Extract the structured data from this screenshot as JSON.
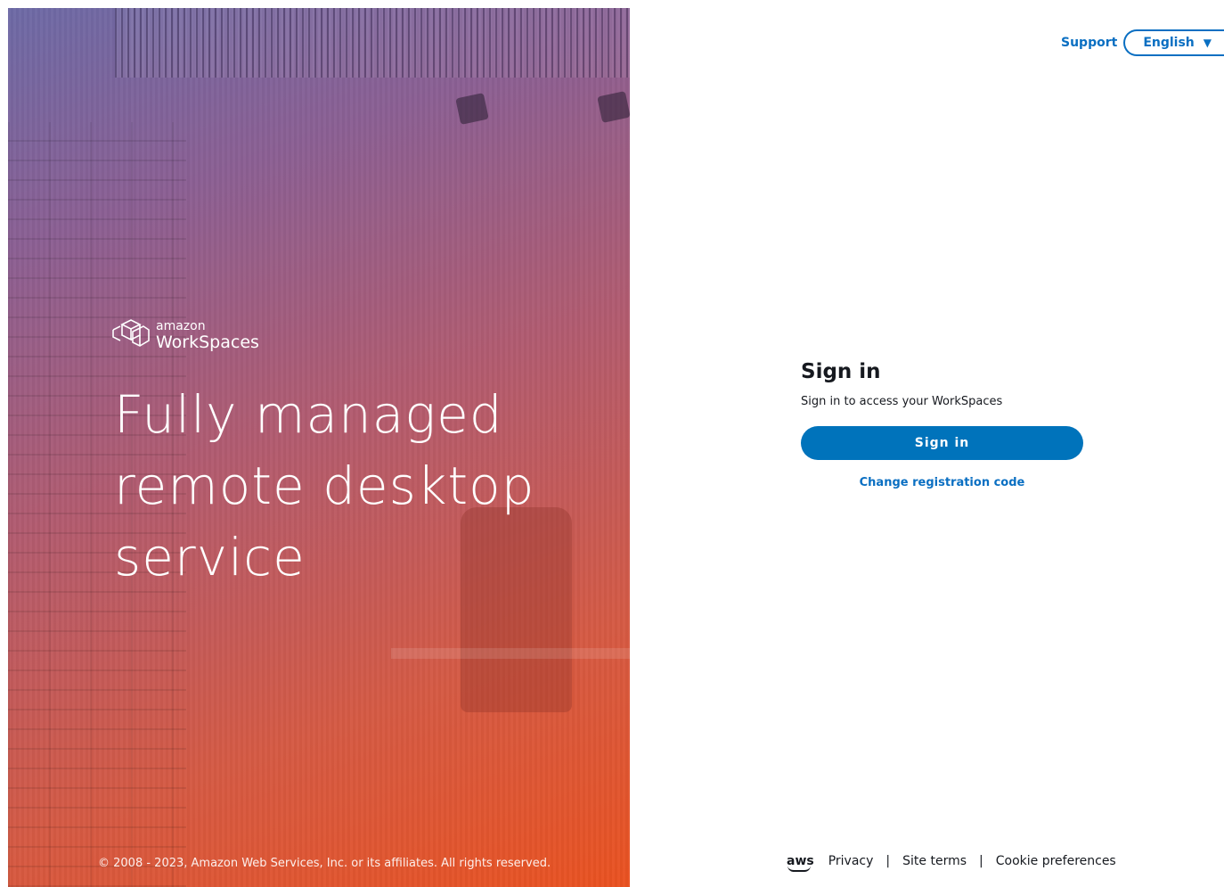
{
  "hero": {
    "brand_small": "amazon",
    "brand_big": "WorkSpaces",
    "headline": [
      "Fully managed",
      "remote desktop",
      "service"
    ],
    "copyright": "© 2008 - 2023, Amazon Web Services, Inc. or its affiliates. All rights reserved."
  },
  "header": {
    "support_label": "Support",
    "language_label": "English"
  },
  "signin": {
    "title": "Sign in",
    "subtitle": "Sign in to access your WorkSpaces",
    "button_label": "Sign in",
    "change_code_label": "Change registration code"
  },
  "footer": {
    "aws_logo_text": "aws",
    "links": [
      "Privacy",
      "Site terms",
      "Cookie preferences"
    ],
    "separator": "|"
  },
  "colors": {
    "accent": "#0073bb",
    "link": "#0a6fc2",
    "text": "#16191f"
  },
  "icons": {
    "brand": "workspaces-cube-icon",
    "language_dropdown": "caret-down-icon"
  }
}
